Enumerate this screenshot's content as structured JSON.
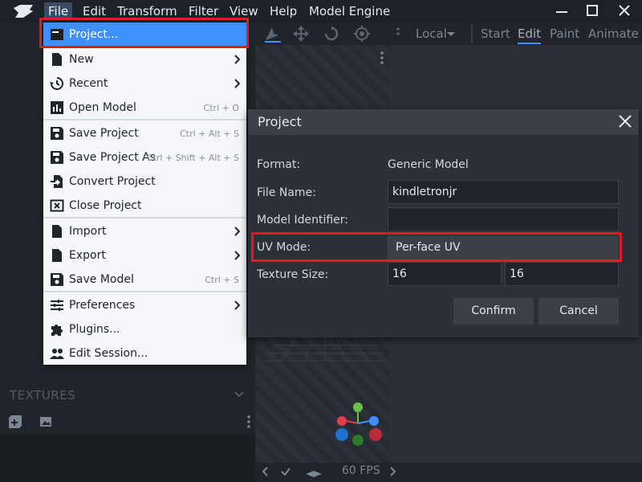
{
  "menubar": {
    "items": [
      "File",
      "Edit",
      "Transform",
      "Filter",
      "View",
      "Help",
      "Model Engine"
    ]
  },
  "toolbar": {
    "space_select": "Local",
    "modes": [
      "Start",
      "Edit",
      "Paint",
      "Animate"
    ]
  },
  "file_menu": {
    "items": [
      {
        "label": "Project...",
        "shortcut": ""
      },
      {
        "label": "New",
        "shortcut": ""
      },
      {
        "label": "Recent",
        "shortcut": ""
      },
      {
        "label": "Open Model",
        "shortcut": "Ctrl + O"
      },
      {
        "label": "Save Project",
        "shortcut": "Ctrl + Alt + S"
      },
      {
        "label": "Save Project As",
        "shortcut": "Ctrl + Shift + Alt + S"
      },
      {
        "label": "Convert Project",
        "shortcut": ""
      },
      {
        "label": "Close Project",
        "shortcut": ""
      },
      {
        "label": "Import",
        "shortcut": ""
      },
      {
        "label": "Export",
        "shortcut": ""
      },
      {
        "label": "Save Model",
        "shortcut": "Ctrl + S"
      },
      {
        "label": "Preferences",
        "shortcut": ""
      },
      {
        "label": "Plugins...",
        "shortcut": ""
      },
      {
        "label": "Edit Session...",
        "shortcut": ""
      }
    ]
  },
  "left_panel": {
    "textures_header": "TEXTURES"
  },
  "dialog": {
    "title": "Project",
    "format_label": "Format:",
    "format_value": "Generic Model",
    "file_name_label": "File Name:",
    "file_name_value": "kindletronjr",
    "model_identifier_label": "Model Identifier:",
    "model_identifier_value": "",
    "uv_mode_label": "UV Mode:",
    "uv_mode_value": "Per-face UV",
    "texture_size_label": "Texture Size:",
    "texture_width": "16",
    "texture_height": "16",
    "confirm_label": "Confirm",
    "cancel_label": "Cancel"
  },
  "viewport": {
    "fps": "60 FPS"
  },
  "colors": {
    "accent": "#3e90ff",
    "highlight_box": "#e01b24",
    "menu_bg": "#f5f6f9",
    "dialog_bg": "#2c3038"
  }
}
